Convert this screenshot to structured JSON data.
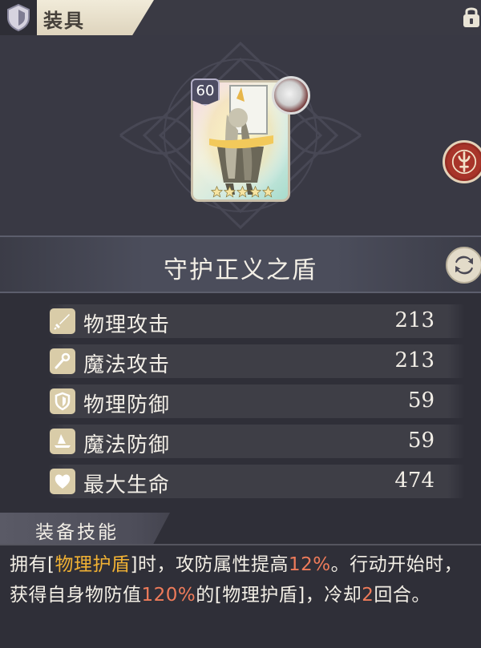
{
  "header": {
    "title": "装具",
    "icons": [
      "shield-icon",
      "lock-icon"
    ]
  },
  "card": {
    "level": "60",
    "stars": 5,
    "icons": [
      "knight-art",
      "avatar",
      "star-icon"
    ]
  },
  "emblem": {
    "icon": "emblem-icon",
    "color": "#a8352a"
  },
  "item": {
    "name": "守护正义之盾"
  },
  "swap": {
    "icon": "swap-icon"
  },
  "stats": [
    {
      "icon": "sword-icon",
      "label": "物理攻击",
      "value": "213"
    },
    {
      "icon": "wand-icon",
      "label": "魔法攻击",
      "value": "213"
    },
    {
      "icon": "shield-icon",
      "label": "物理防御",
      "value": "59"
    },
    {
      "icon": "witch-hat-icon",
      "label": "魔法防御",
      "value": "59"
    },
    {
      "icon": "heart-icon",
      "label": "最大生命",
      "value": "474"
    }
  ],
  "skill": {
    "title": "装备技能",
    "parts": [
      "拥有[",
      "物理护盾",
      "]时，攻防属性提高",
      "12%",
      "。行动开始时，获得自身物防值",
      "120%",
      "的[物理护盾]，冷却",
      "2",
      "回合。"
    ]
  },
  "colors": {
    "highlight_gold": "#f1b234",
    "highlight_orange": "#ee7b5a",
    "background": "#2f2f38"
  }
}
